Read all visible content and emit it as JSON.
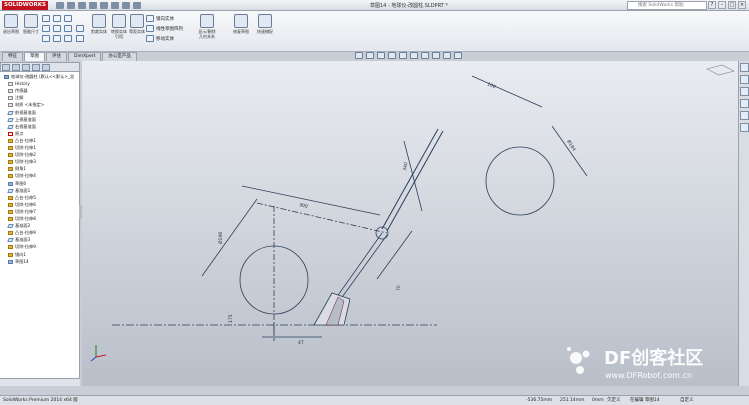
{
  "app": {
    "logo_text": "SOLIDWORKS",
    "window_title": "草图14 - 地球仪-改圆柱.SLDPRT *",
    "search_placeholder": "搜索 SolidWorks 帮助"
  },
  "ribbon": {
    "buttons": [
      {
        "label": "退出草图"
      },
      {
        "label": "智能尺寸"
      },
      {
        "label": "剪裁实体"
      },
      {
        "label": "转换实体引用"
      },
      {
        "label": "等距实体"
      },
      {
        "label": "显示/删除几何关系"
      },
      {
        "label": "修复草图"
      },
      {
        "label": "快速捕捉"
      }
    ],
    "text_commands": [
      "镜向实体",
      "线性草图阵列",
      "移动实体"
    ]
  },
  "tabs": [
    "特征",
    "草图",
    "评估",
    "DimXpert",
    "办公室产品"
  ],
  "tabs_active_index": 1,
  "tree": {
    "items": [
      {
        "label": "地球仪-改圆柱 (默认<<默认>_显",
        "kind": "part"
      },
      {
        "label": "History",
        "kind": "hist"
      },
      {
        "label": "传感器",
        "kind": "hist"
      },
      {
        "label": "注解",
        "kind": "hist"
      },
      {
        "label": "材质 <未指定>",
        "kind": "hist"
      },
      {
        "label": "前视基准面",
        "kind": "plane"
      },
      {
        "label": "上视基准面",
        "kind": "plane"
      },
      {
        "label": "右视基准面",
        "kind": "plane"
      },
      {
        "label": "原点",
        "kind": "origin"
      },
      {
        "label": "凸台-拉伸1",
        "kind": "feat"
      },
      {
        "label": "切除-拉伸1",
        "kind": "feat"
      },
      {
        "label": "切除-拉伸2",
        "kind": "feat"
      },
      {
        "label": "切除-拉伸3",
        "kind": "feat"
      },
      {
        "label": "倒角1",
        "kind": "feat"
      },
      {
        "label": "切除-拉伸4",
        "kind": "feat"
      },
      {
        "label": "草图6",
        "kind": "gray"
      },
      {
        "label": "基准面1",
        "kind": "plane"
      },
      {
        "label": "凸台-拉伸5",
        "kind": "feat"
      },
      {
        "label": "切除-拉伸6",
        "kind": "feat"
      },
      {
        "label": "切除-拉伸7",
        "kind": "feat"
      },
      {
        "label": "切除-拉伸8",
        "kind": "feat"
      },
      {
        "label": "基准面2",
        "kind": "plane"
      },
      {
        "label": "凸台-拉伸9",
        "kind": "feat"
      },
      {
        "label": "基准面3",
        "kind": "plane"
      },
      {
        "label": "切除-拉伸9",
        "kind": "feat"
      },
      {
        "label": "镜向1",
        "kind": "feat"
      },
      {
        "label": "草图14",
        "kind": "gray"
      }
    ]
  },
  "sketch": {
    "dimensions": [
      "100",
      "Ø184",
      "340",
      "Ø198",
      "175",
      "300",
      "70",
      "47"
    ]
  },
  "status": {
    "product": "SolidWorks Premium 2014 x64 版",
    "x": "-536.75mm",
    "y": "251.14mm",
    "z": "0mm",
    "state": "欠定义",
    "mode": "在编辑 草图14",
    "units": "自定义"
  },
  "watermark": {
    "title": "DF创客社区",
    "url": "www.DFRobot.com.cn"
  }
}
